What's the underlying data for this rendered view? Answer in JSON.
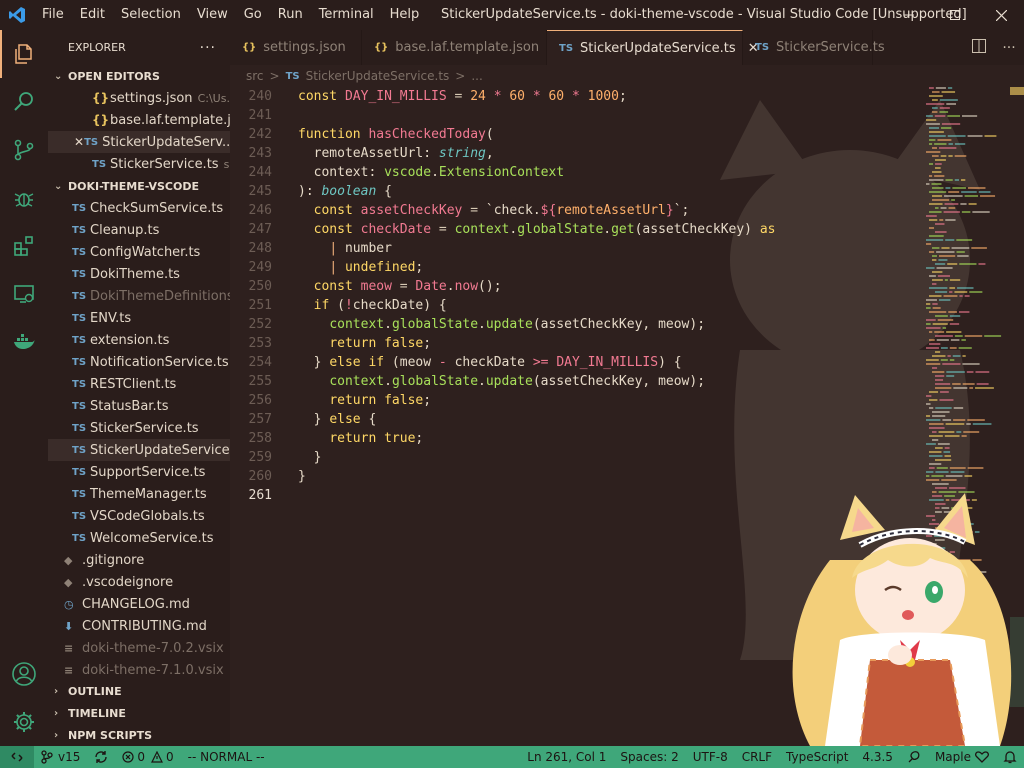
{
  "window": {
    "title": "StickerUpdateService.ts - doki-theme-vscode - Visual Studio Code [Unsupported]",
    "menu": [
      "File",
      "Edit",
      "Selection",
      "View",
      "Go",
      "Run",
      "Terminal",
      "Help"
    ]
  },
  "sidebar": {
    "title": "EXPLORER",
    "open_editors_label": "OPEN EDITORS",
    "open_editors": [
      {
        "icon": "{}",
        "name": "settings.json",
        "path": "C:\\Us...",
        "selected": false
      },
      {
        "icon": "{}",
        "name": "base.laf.template.j...",
        "path": "",
        "selected": false
      },
      {
        "icon": "TS",
        "name": "StickerUpdateServ...",
        "path": "",
        "selected": true,
        "closable": true
      },
      {
        "icon": "TS",
        "name": "StickerService.ts",
        "path": "src",
        "selected": false
      }
    ],
    "project_label": "DOKI-THEME-VSCODE",
    "files": [
      {
        "icon": "TS",
        "name": "CheckSumService.ts"
      },
      {
        "icon": "TS",
        "name": "Cleanup.ts"
      },
      {
        "icon": "TS",
        "name": "ConfigWatcher.ts"
      },
      {
        "icon": "TS",
        "name": "DokiTheme.ts"
      },
      {
        "icon": "TS",
        "name": "DokiThemeDefinitions...",
        "dim": true
      },
      {
        "icon": "TS",
        "name": "ENV.ts"
      },
      {
        "icon": "TS",
        "name": "extension.ts"
      },
      {
        "icon": "TS",
        "name": "NotificationService.ts"
      },
      {
        "icon": "TS",
        "name": "RESTClient.ts"
      },
      {
        "icon": "TS",
        "name": "StatusBar.ts"
      },
      {
        "icon": "TS",
        "name": "StickerService.ts"
      },
      {
        "icon": "TS",
        "name": "StickerUpdateService.ts",
        "selected": true
      },
      {
        "icon": "TS",
        "name": "SupportService.ts"
      },
      {
        "icon": "TS",
        "name": "ThemeManager.ts"
      },
      {
        "icon": "TS",
        "name": "VSCodeGlobals.ts"
      },
      {
        "icon": "TS",
        "name": "WelcomeService.ts"
      }
    ],
    "root_files": [
      {
        "icon": "gitignore",
        "name": ".gitignore"
      },
      {
        "icon": "vscodeignore",
        "name": ".vscodeignore"
      },
      {
        "icon": "changelog",
        "name": "CHANGELOG.md"
      },
      {
        "icon": "contributing",
        "name": "CONTRIBUTING.md"
      },
      {
        "icon": "vsix",
        "name": "doki-theme-7.0.2.vsix",
        "dim": true
      },
      {
        "icon": "vsix",
        "name": "doki-theme-7.1.0.vsix",
        "dim": true
      }
    ],
    "bottom_sections": [
      "OUTLINE",
      "TIMELINE",
      "NPM SCRIPTS"
    ]
  },
  "tabs": [
    {
      "icon": "{}",
      "label": "settings.json",
      "active": false
    },
    {
      "icon": "{}",
      "label": "base.laf.template.json",
      "active": false
    },
    {
      "icon": "TS",
      "label": "StickerUpdateService.ts",
      "active": true
    },
    {
      "icon": "TS",
      "label": "StickerService.ts",
      "active": false
    }
  ],
  "breadcrumbs": [
    "src",
    ">",
    "TS",
    "StickerUpdateService.ts",
    ">",
    "..."
  ],
  "code": {
    "line_numbers": [
      "240",
      "241",
      "242",
      "243",
      "244",
      "245",
      "246",
      "247",
      "248",
      "249",
      "250",
      "251",
      "252",
      "253",
      "254",
      "255",
      "256",
      "257",
      "258",
      "259",
      "260",
      "261"
    ],
    "current_line": "261"
  },
  "status": {
    "branch": "v15",
    "errors": "0",
    "warnings": "0",
    "mode": "-- NORMAL --",
    "position": "Ln 261, Col 1",
    "spaces": "Spaces: 2",
    "encoding": "UTF-8",
    "eol": "CRLF",
    "language": "TypeScript",
    "ts_version": "4.3.5",
    "theme": "Maple"
  },
  "colors": {
    "accent": "#f0b07b",
    "status_bar": "#3fa77a",
    "background": "#2e201e"
  }
}
